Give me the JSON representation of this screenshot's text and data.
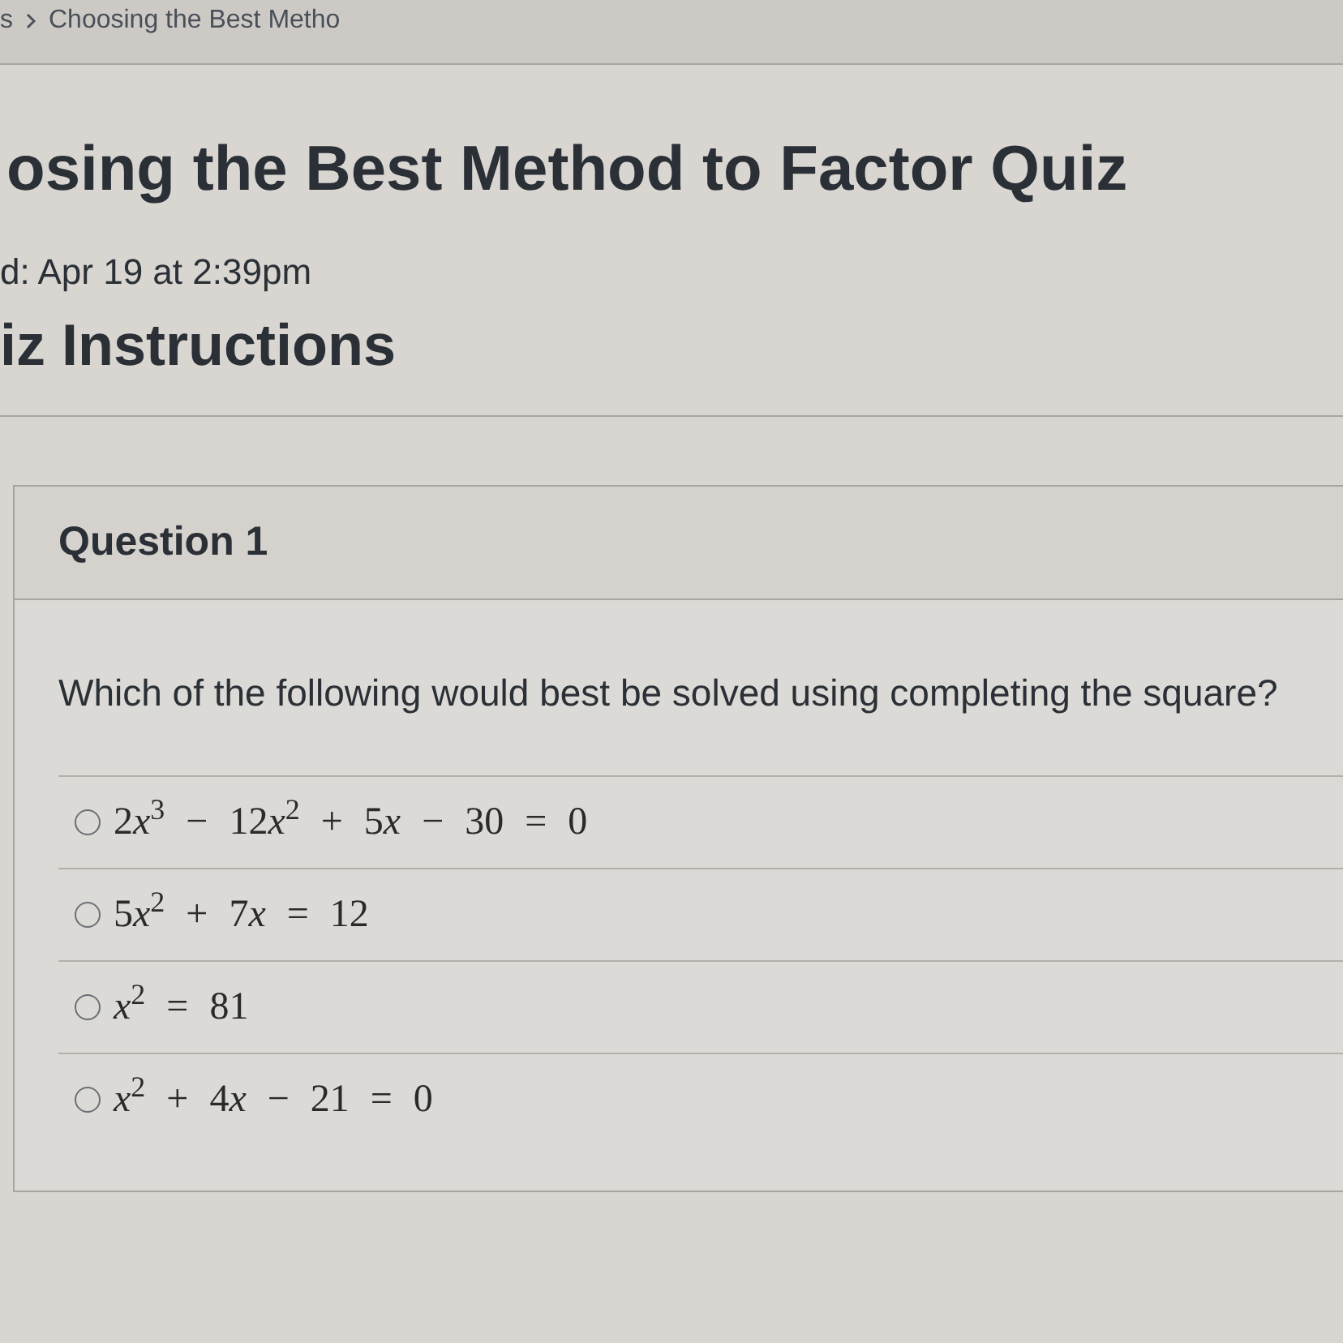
{
  "breadcrumb": [
    "s",
    "Choosing the Best Metho"
  ],
  "quiz": {
    "title": "osing the Best Method to Factor Quiz",
    "started": "d: Apr 19 at 2:39pm",
    "instructions_heading": "iz Instructions"
  },
  "question": {
    "header": "Question 1",
    "prompt": "Which of the following would best be solved using completing the square?",
    "options": [
      {
        "label": "2x$^{3}$ − 12x$^{2}$ + 5x − 30 = 0",
        "selected": false
      },
      {
        "label": "5x$^{2}$ + 7x = 12",
        "selected": false
      },
      {
        "label": "x$^{2}$ = 81",
        "selected": false
      },
      {
        "label": "x$^{2}$ + 4x − 21 = 0",
        "selected": false
      }
    ]
  }
}
